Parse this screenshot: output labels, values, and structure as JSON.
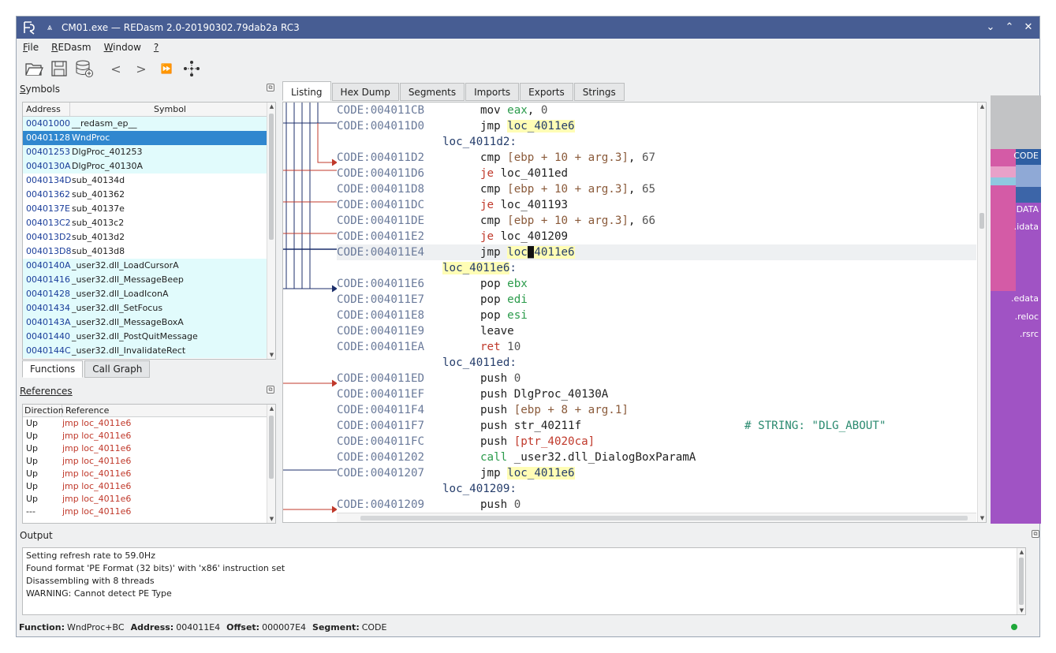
{
  "window": {
    "title": "CM01.exe — REDasm 2.0-20190302.79dab2a RC3",
    "keep_above_glyph": "⩓",
    "btn_min": "⌄",
    "btn_max": "⌃",
    "btn_close": "✕"
  },
  "menu": [
    {
      "first": "F",
      "rest": "ile"
    },
    {
      "first": "R",
      "rest": "EDasm"
    },
    {
      "first": "W",
      "rest": "indow"
    },
    {
      "first": "?",
      "rest": ""
    }
  ],
  "toolbar": {
    "back": "<",
    "forward": ">",
    "goto": "⏩"
  },
  "symbols_panel": {
    "title_first": "S",
    "title_rest": "ymbols",
    "col_address": "Address",
    "col_symbol": "Symbol",
    "rows": [
      {
        "addr": "00401000",
        "name": "__redasm_ep__",
        "state": "hl"
      },
      {
        "addr": "00401128",
        "name": "WndProc",
        "state": "sel"
      },
      {
        "addr": "00401253",
        "name": "DlgProc_401253",
        "state": "hl"
      },
      {
        "addr": "0040130A",
        "name": "DlgProc_40130A",
        "state": "hl"
      },
      {
        "addr": "0040134D",
        "name": "sub_40134d",
        "state": ""
      },
      {
        "addr": "00401362",
        "name": "sub_401362",
        "state": ""
      },
      {
        "addr": "0040137E",
        "name": "sub_40137e",
        "state": ""
      },
      {
        "addr": "004013C2",
        "name": "sub_4013c2",
        "state": ""
      },
      {
        "addr": "004013D2",
        "name": "sub_4013d2",
        "state": ""
      },
      {
        "addr": "004013D8",
        "name": "sub_4013d8",
        "state": ""
      },
      {
        "addr": "0040140A",
        "name": "_user32.dll_LoadCursorA",
        "state": "hl"
      },
      {
        "addr": "00401416",
        "name": "_user32.dll_MessageBeep",
        "state": "hl"
      },
      {
        "addr": "00401428",
        "name": "_user32.dll_LoadIconA",
        "state": "hl"
      },
      {
        "addr": "00401434",
        "name": "_user32.dll_SetFocus",
        "state": "hl"
      },
      {
        "addr": "0040143A",
        "name": "_user32.dll_MessageBoxA",
        "state": "hl"
      },
      {
        "addr": "00401440",
        "name": "_user32.dll_PostQuitMessage",
        "state": "hl"
      },
      {
        "addr": "0040144C",
        "name": "_user32.dll_InvalidateRect",
        "state": "hl"
      }
    ],
    "tab_functions": "Functions",
    "tab_callgraph": "Call Graph"
  },
  "references_panel": {
    "title": "References",
    "col_direction": "Direction",
    "col_reference": "Reference",
    "rows": [
      {
        "dir": "Up",
        "ref": "jmp loc_4011e6"
      },
      {
        "dir": "Up",
        "ref": "jmp loc_4011e6"
      },
      {
        "dir": "Up",
        "ref": "jmp loc_4011e6"
      },
      {
        "dir": "Up",
        "ref": "jmp loc_4011e6"
      },
      {
        "dir": "Up",
        "ref": "jmp loc_4011e6"
      },
      {
        "dir": "Up",
        "ref": "jmp loc_4011e6"
      },
      {
        "dir": "Up",
        "ref": "jmp loc_4011e6"
      },
      {
        "dir": "---",
        "ref": "jmp loc_4011e6"
      }
    ]
  },
  "main_tabs": [
    "Listing",
    "Hex Dump",
    "Segments",
    "Imports",
    "Exports",
    "Strings"
  ],
  "listing": {
    "l0": {
      "addr": "CODE:004011CB",
      "mn": "mov",
      "a": "eax",
      "b": "0"
    },
    "l1": {
      "addr": "CODE:004011D0",
      "mn": "jmp",
      "target": "loc_4011e6"
    },
    "l2": {
      "label": "loc_4011d2:"
    },
    "l3": {
      "addr": "CODE:004011D2",
      "mn": "cmp",
      "mem": "[ebp + 10 + arg.3]",
      "num": "67"
    },
    "l4": {
      "addr": "CODE:004011D6",
      "mn": "je",
      "target": "loc_4011ed"
    },
    "l5": {
      "addr": "CODE:004011D8",
      "mn": "cmp",
      "mem": "[ebp + 10 + arg.3]",
      "num": "65"
    },
    "l6": {
      "addr": "CODE:004011DC",
      "mn": "je",
      "target": "loc_401193"
    },
    "l7": {
      "addr": "CODE:004011DE",
      "mn": "cmp",
      "mem": "[ebp + 10 + arg.3]",
      "num": "66"
    },
    "l8": {
      "addr": "CODE:004011E2",
      "mn": "je",
      "target": "loc_401209"
    },
    "l9": {
      "addr": "CODE:004011E4",
      "mn": "jmp",
      "t1": "loc",
      "t2": "_",
      "t3": "4011e6"
    },
    "l10": {
      "label": "loc_4011e6",
      "colon": ":"
    },
    "l11": {
      "addr": "CODE:004011E6",
      "mn": "pop",
      "reg": "ebx"
    },
    "l12": {
      "addr": "CODE:004011E7",
      "mn": "pop",
      "reg": "edi"
    },
    "l13": {
      "addr": "CODE:004011E8",
      "mn": "pop",
      "reg": "esi"
    },
    "l14": {
      "addr": "CODE:004011E9",
      "mn": "leave"
    },
    "l15": {
      "addr": "CODE:004011EA",
      "mn": "ret",
      "num": "10"
    },
    "l16": {
      "label": "loc_4011ed:"
    },
    "l17": {
      "addr": "CODE:004011ED",
      "mn": "push",
      "num": "0"
    },
    "l18": {
      "addr": "CODE:004011EF",
      "mn": "push",
      "op": "DlgProc_40130A"
    },
    "l19": {
      "addr": "CODE:004011F4",
      "mn": "push",
      "mem": "[ebp + 8 + arg.1]"
    },
    "l20": {
      "addr": "CODE:004011F7",
      "mn": "push",
      "op": "str_40211f",
      "comment": "# STRING: \"DLG_ABOUT\""
    },
    "l21": {
      "addr": "CODE:004011FC",
      "mn": "push",
      "ptr": "[ptr_4020ca]"
    },
    "l22": {
      "addr": "CODE:00401202",
      "mn": "call",
      "op": "_user32.dll_DialogBoxParamA"
    },
    "l23": {
      "addr": "CODE:00401207",
      "mn": "jmp",
      "target": "loc_4011e6"
    },
    "l24": {
      "label": "loc_401209:"
    },
    "l25": {
      "addr": "CODE:00401209",
      "mn": "push",
      "num": "0"
    }
  },
  "segment_map": {
    "labels": [
      "CODE",
      "DATA",
      ".idata",
      ".edata",
      ".reloc",
      ".rsrc"
    ],
    "colors": {
      "bg": "#a053c4",
      "code": "#d45ba6",
      "header": "#c2c3c5",
      "code_label_bg": "#2f5fa3"
    }
  },
  "output": {
    "title": "Output",
    "lines": [
      "Setting refresh rate to 59.0Hz",
      "Found format 'PE Format (32 bits)' with 'x86' instruction set",
      "Disassembling with 8 threads",
      "WARNING: Cannot detect PE Type"
    ]
  },
  "status": {
    "function_label": "Function:",
    "function_value": "WndProc+BC",
    "address_label": "Address:",
    "address_value": "004011E4",
    "offset_label": "Offset:",
    "offset_value": "000007E4",
    "segment_label": "Segment:",
    "segment_value": "CODE"
  }
}
